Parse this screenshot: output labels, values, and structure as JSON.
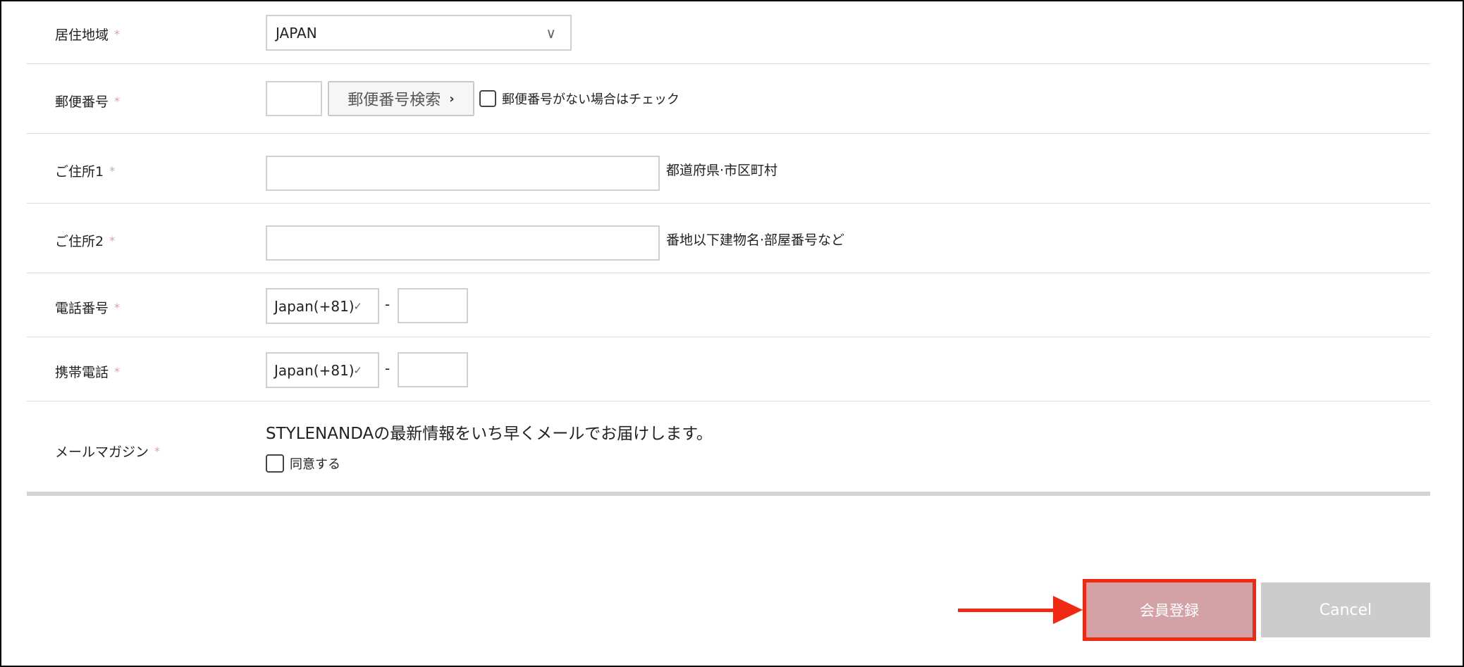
{
  "form": {
    "required_mark": "*",
    "rows": {
      "region": {
        "label": "居住地域",
        "value": "JAPAN"
      },
      "postal": {
        "label": "郵便番号",
        "search_button": "郵便番号検索",
        "no_postal_label": "郵便番号がない場合はチェック"
      },
      "address1": {
        "label": "ご住所1",
        "hint": "都道府県·市区町村"
      },
      "address2": {
        "label": "ご住所2",
        "hint": "番地以下建物名·部屋番号など"
      },
      "phone": {
        "label": "電話番号",
        "country": "Japan(+81)",
        "separator": "-"
      },
      "mobile": {
        "label": "携帯電話",
        "country": "Japan(+81)",
        "separator": "-"
      },
      "newsletter": {
        "label": "メールマガジン",
        "description": "STYLENANDAの最新情報をいち早くメールでお届けします。",
        "agree_label": "同意する"
      }
    }
  },
  "actions": {
    "submit": "会員登録",
    "cancel": "Cancel"
  },
  "colors": {
    "accent_pink": "#d4a1a6",
    "highlight_red": "#f02a12",
    "cancel_gray": "#cccccc"
  }
}
